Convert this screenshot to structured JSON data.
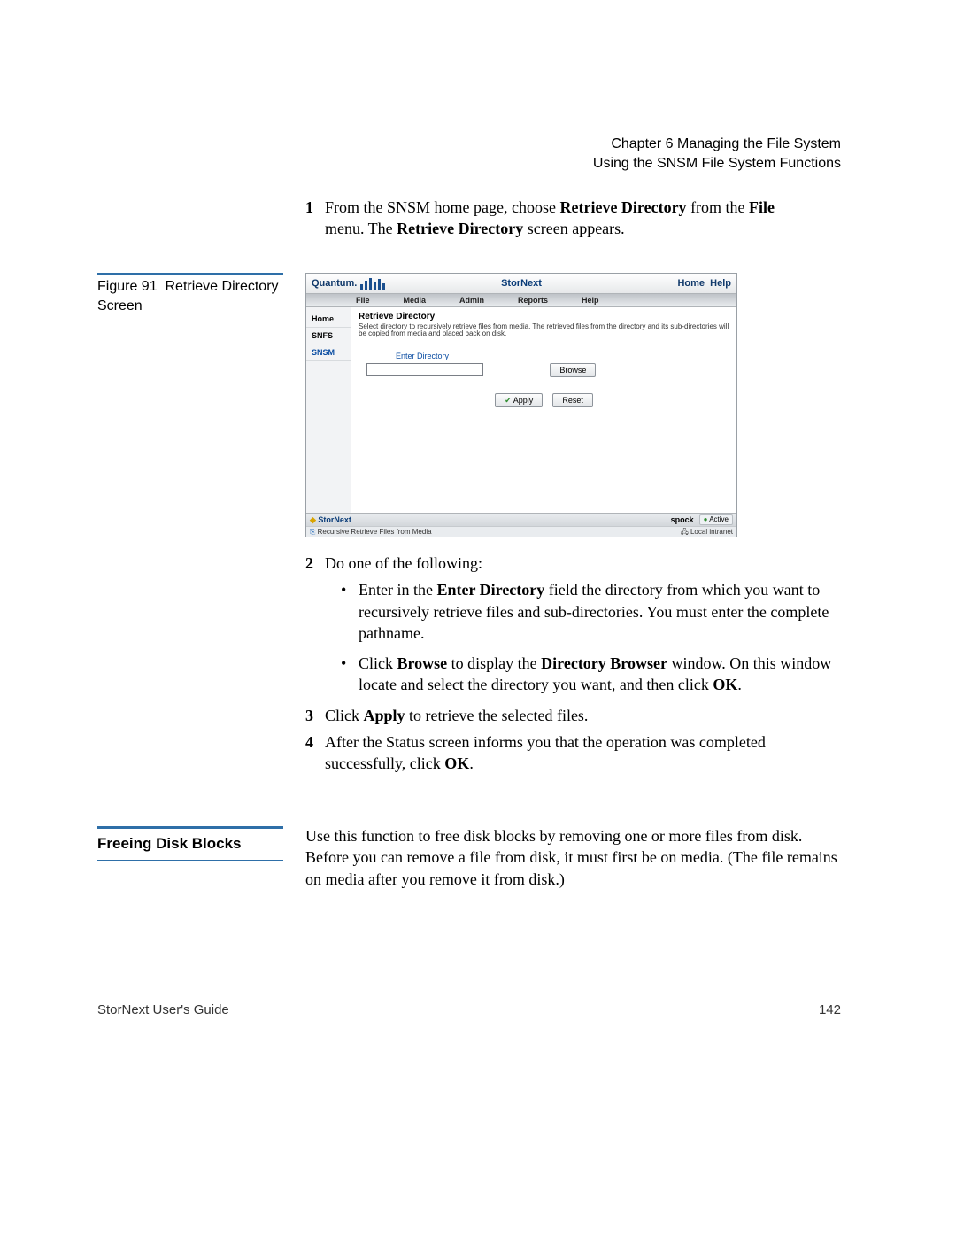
{
  "header": {
    "chapter": "Chapter 6  Managing the File System",
    "section": "Using the SNSM File System Functions"
  },
  "step1": {
    "num": "1",
    "pre": "From the SNSM home page, choose ",
    "b1": "Retrieve Directory",
    "mid": " from the ",
    "b2": "File",
    "line2a": "menu. The ",
    "line2b": "Retrieve Directory",
    "line2c": " screen appears."
  },
  "figure": {
    "num": "Figure 91",
    "title": "Retrieve Directory Screen"
  },
  "screenshot": {
    "brand": "Quantum.",
    "title": "StorNext",
    "home": "Home",
    "help": "Help",
    "menu": {
      "file": "File",
      "media": "Media",
      "admin": "Admin",
      "reports": "Reports",
      "helpm": "Help"
    },
    "side": {
      "home": "Home",
      "snfs": "SNFS",
      "snsm": "SNSM"
    },
    "panel_title": "Retrieve Directory",
    "panel_desc": "Select directory to recursively retrieve files from media. The retrieved files from the directory and its sub-directories will be copied from media and placed back on disk.",
    "input_label": "Enter Directory",
    "browse": "Browse",
    "apply": "Apply",
    "reset": "Reset",
    "footer_brand": "StorNext",
    "host": "spock",
    "active": "Active",
    "status_left": "Recursive Retrieve Files from Media",
    "status_right": "Local intranet"
  },
  "step2": {
    "num": "2",
    "text": "Do one of the following:",
    "bullet1": {
      "pre": "Enter in the ",
      "b": "Enter Directory",
      "post": " field the directory from which you want to recursively retrieve files and sub-directories. You must enter the complete pathname."
    },
    "bullet2": {
      "pre": "Click ",
      "b1": "Browse",
      "mid": " to display the ",
      "b2": "Directory Browser",
      "post": " window. On this window locate and select the directory you want, and then click ",
      "b3": "OK",
      "end": "."
    }
  },
  "step3": {
    "num": "3",
    "pre": "Click ",
    "b": "Apply",
    "post": " to retrieve the selected files."
  },
  "step4": {
    "num": "4",
    "pre": "After the Status screen informs you that the operation was completed successfully, click ",
    "b": "OK",
    "post": "."
  },
  "section2": {
    "title": "Freeing Disk Blocks",
    "body": "Use this function to free disk blocks by removing one or more files from disk. Before you can remove a file from disk, it must first be on media. (The file remains on media after you remove it from disk.)"
  },
  "footer": {
    "left": "StorNext User's Guide",
    "right": "142"
  }
}
